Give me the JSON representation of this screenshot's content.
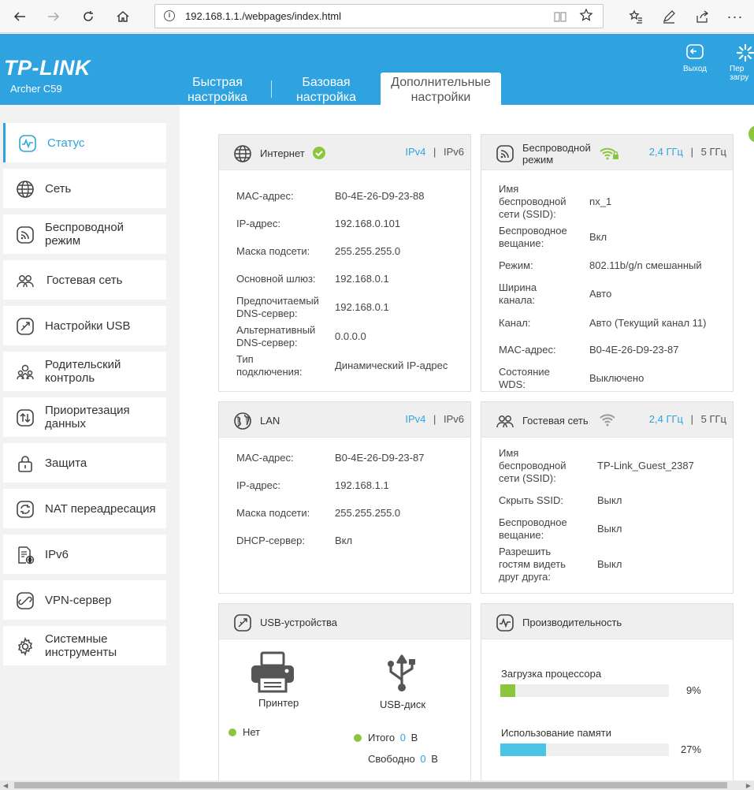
{
  "browser": {
    "url": "192.168.1.1./webpages/index.html"
  },
  "header": {
    "brand": "TP-LINK",
    "model": "Archer C59",
    "tabs": [
      {
        "line1": "Быстрая",
        "line2": "настройка"
      },
      {
        "line1": "Базовая",
        "line2": "настройка"
      },
      {
        "line1": "Дополнительные",
        "line2": "настройки"
      }
    ],
    "logout": "Выход",
    "reboot_1": "Пер",
    "reboot_2": "загру"
  },
  "sidebar": {
    "items": [
      {
        "l1": "Статус",
        "l2": ""
      },
      {
        "l1": "Сеть",
        "l2": ""
      },
      {
        "l1": "Беспроводной",
        "l2": "режим"
      },
      {
        "l1": "Гостевая сеть",
        "l2": ""
      },
      {
        "l1": "Настройки USB",
        "l2": ""
      },
      {
        "l1": "Родительский",
        "l2": "контроль"
      },
      {
        "l1": "Приоритезация",
        "l2": "данных"
      },
      {
        "l1": "Защита",
        "l2": ""
      },
      {
        "l1": "NAT переадресация",
        "l2": ""
      },
      {
        "l1": "IPv6",
        "l2": ""
      },
      {
        "l1": "VPN-сервер",
        "l2": ""
      },
      {
        "l1": "Системные",
        "l2": "инструменты"
      }
    ]
  },
  "internet": {
    "title": "Интернет",
    "ipv4": "IPv4",
    "sep": "|",
    "ipv6": "IPv6",
    "rows": [
      {
        "l1": "MAC-адрес:",
        "l2": "",
        "v": "B0-4E-26-D9-23-88"
      },
      {
        "l1": "IP-адрес:",
        "l2": "",
        "v": "192.168.0.101"
      },
      {
        "l1": "Маска подсети:",
        "l2": "",
        "v": "255.255.255.0"
      },
      {
        "l1": "Основной шлюз:",
        "l2": "",
        "v": "192.168.0.1"
      },
      {
        "l1": "Предпочитаемый",
        "l2": "DNS-сервер:",
        "v": "192.168.0.1"
      },
      {
        "l1": "Альтернативный",
        "l2": "DNS-сервер:",
        "v": "0.0.0.0"
      },
      {
        "l1": "Тип",
        "l2": "подключения:",
        "v": "Динамический IP-адрес"
      }
    ]
  },
  "wireless": {
    "title1": "Беспроводной",
    "title2": "режим",
    "band24": "2,4 ГГц",
    "sep": "|",
    "band5": "5 ГГц",
    "rows": [
      {
        "l1": "Имя",
        "l2": "беспроводной",
        "l3": "сети (SSID):",
        "v": "nx_1"
      },
      {
        "l1": "Беспроводное",
        "l2": "вещание:",
        "l3": "",
        "v": "Вкл"
      },
      {
        "l1": "Режим:",
        "l2": "",
        "l3": "",
        "v": "802.11b/g/n смешанный"
      },
      {
        "l1": "Ширина",
        "l2": "канала:",
        "l3": "",
        "v": "Авто"
      },
      {
        "l1": "Канал:",
        "l2": "",
        "l3": "",
        "v": "Авто (Текущий канал 11)"
      },
      {
        "l1": "MAC-адрес:",
        "l2": "",
        "l3": "",
        "v": "B0-4E-26-D9-23-87"
      },
      {
        "l1": "Состояние",
        "l2": "WDS:",
        "l3": "",
        "v": "Выключено"
      }
    ]
  },
  "lan": {
    "title": "LAN",
    "ipv4": "IPv4",
    "sep": "|",
    "ipv6": "IPv6",
    "rows": [
      {
        "l": "MAC-адрес:",
        "v": "B0-4E-26-D9-23-87"
      },
      {
        "l": "IP-адрес:",
        "v": "192.168.1.1"
      },
      {
        "l": "Маска подсети:",
        "v": "255.255.255.0"
      },
      {
        "l": "DHCP-сервер:",
        "v": "Вкл"
      }
    ]
  },
  "guest": {
    "title": "Гостевая сеть",
    "band24": "2,4 ГГц",
    "sep": "|",
    "band5": "5 ГГц",
    "rows": [
      {
        "l1": "Имя",
        "l2": "беспроводной",
        "l3": "сети (SSID):",
        "v": "TP-Link_Guest_2387"
      },
      {
        "l1": "Скрыть SSID:",
        "l2": "",
        "l3": "",
        "v": "Выкл"
      },
      {
        "l1": "Беспроводное",
        "l2": "вещание:",
        "l3": "",
        "v": "Выкл"
      },
      {
        "l1": "Разрешить",
        "l2": "гостям видеть",
        "l3": "друг друга:",
        "v": "Выкл"
      }
    ]
  },
  "usb": {
    "title": "USB-устройства",
    "printer": "Принтер",
    "printer_status": "Нет",
    "disk": "USB-диск",
    "total_label": "Итого",
    "total_value": "0",
    "total_unit": "B",
    "free_label": "Свободно",
    "free_value": "0",
    "free_unit": "B"
  },
  "performance": {
    "title": "Производительность",
    "cpu_label": "Загрузка процессора",
    "cpu_value": "9%",
    "cpu_fraction": 0.09,
    "mem_label": "Использование памяти",
    "mem_value": "27%",
    "mem_fraction": 0.27
  },
  "colors": {
    "accent": "#2fa3df",
    "ok": "#8cc63f",
    "mem_bar": "#4bc3e6"
  }
}
